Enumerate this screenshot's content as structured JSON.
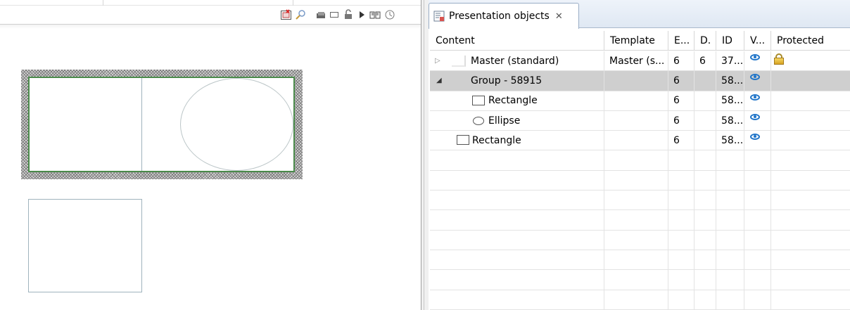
{
  "tab": {
    "title": "Presentation objects",
    "close_glyph": "✕"
  },
  "columns": {
    "content": "Content",
    "template": "Template",
    "e": "E...",
    "d": "D.",
    "id": "ID",
    "v": "V...",
    "protected": "Protected"
  },
  "rows": [
    {
      "content": "Master (standard)",
      "template": "Master (s...",
      "e": "6",
      "d": "6",
      "id": "37...",
      "visible": true,
      "protected": true,
      "expander": "collapsed",
      "icon": "master-icon"
    },
    {
      "content": "Group - 58915",
      "template": "",
      "e": "6",
      "d": "",
      "id": "58...",
      "visible": true,
      "protected": false,
      "expander": "expanded",
      "icon": "none",
      "selected": true
    },
    {
      "content": "Rectangle",
      "template": "",
      "e": "6",
      "d": "",
      "id": "58...",
      "visible": true,
      "protected": false,
      "icon": "rectangle-icon"
    },
    {
      "content": "Ellipse",
      "template": "",
      "e": "6",
      "d": "",
      "id": "58...",
      "visible": true,
      "protected": false,
      "icon": "ellipse-icon"
    },
    {
      "content": "Rectangle",
      "template": "",
      "e": "6",
      "d": "",
      "id": "58...",
      "visible": true,
      "protected": false,
      "icon": "rectangle-icon"
    }
  ],
  "empty_row_count": 8,
  "toolbar": {
    "tools": [
      "unlink-icon",
      "magnifier-icon",
      "layers-icon",
      "rectangle-tool-icon",
      "lock-icon",
      "play-icon",
      "book-icon",
      "clock-icon"
    ]
  },
  "colors": {
    "selection_row": "#cfcfcf",
    "group_border": "#4a8a4a",
    "visibility_eye": "#1f74c8"
  }
}
